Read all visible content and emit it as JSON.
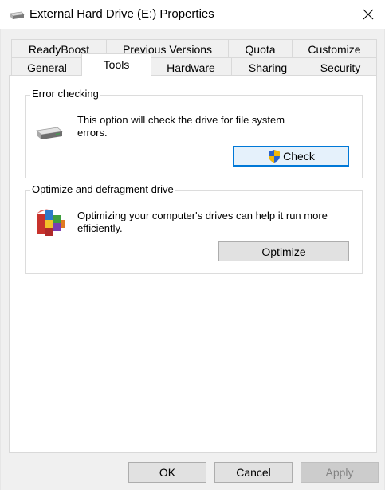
{
  "window": {
    "title": "External Hard Drive (E:) Properties",
    "icon": "external-drive-icon",
    "close_icon": "close-icon"
  },
  "tabs": {
    "row1": [
      "ReadyBoost",
      "Previous Versions",
      "Quota",
      "Customize"
    ],
    "row2": [
      "General",
      "Tools",
      "Hardware",
      "Sharing",
      "Security"
    ],
    "active": "Tools"
  },
  "error_checking": {
    "legend": "Error checking",
    "icon": "hard-drive-icon",
    "line1": "This option will check the drive for file system",
    "line2": "errors.",
    "button": "Check",
    "button_icon": "uac-shield-icon"
  },
  "optimize": {
    "legend": "Optimize and defragment drive",
    "icon": "defragment-icon",
    "line1": "Optimizing your computer's drives can help it run more",
    "line2": "efficiently.",
    "button": "Optimize"
  },
  "footer": {
    "ok": "OK",
    "cancel": "Cancel",
    "apply": "Apply"
  },
  "colors": {
    "focus_border": "#0078d7",
    "dialog_bg": "#f0f0f0",
    "panel_bg": "#ffffff"
  }
}
